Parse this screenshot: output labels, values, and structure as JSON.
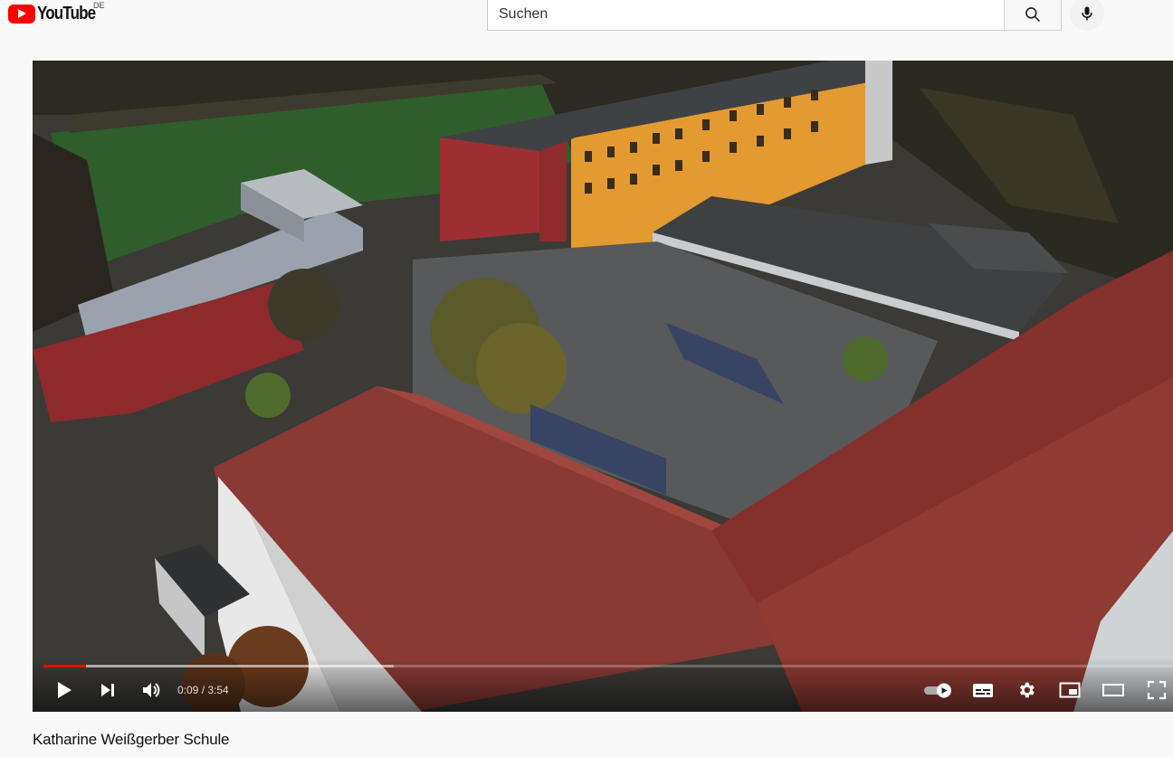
{
  "brand": {
    "name": "YouTube",
    "country": "DE"
  },
  "search": {
    "placeholder": "Suchen",
    "button_icon": "search-icon",
    "mic_icon": "microphone-icon"
  },
  "player": {
    "current_time": "0:09",
    "duration": "3:54",
    "time_display": "0:09 / 3:54",
    "progress": 0.038,
    "buffered": 0.31,
    "controls": [
      "play-icon",
      "next-icon",
      "volume-icon",
      "autoplay-toggle-icon",
      "subtitles-icon",
      "settings-icon",
      "miniplayer-icon",
      "theater-mode-icon",
      "fullscreen-icon"
    ]
  },
  "video": {
    "title": "Katharine Weißgerber Schule"
  },
  "colors": {
    "brand_red": "#ff0000",
    "progress_red": "#ff0000",
    "page_bg": "#f9f9f9"
  }
}
